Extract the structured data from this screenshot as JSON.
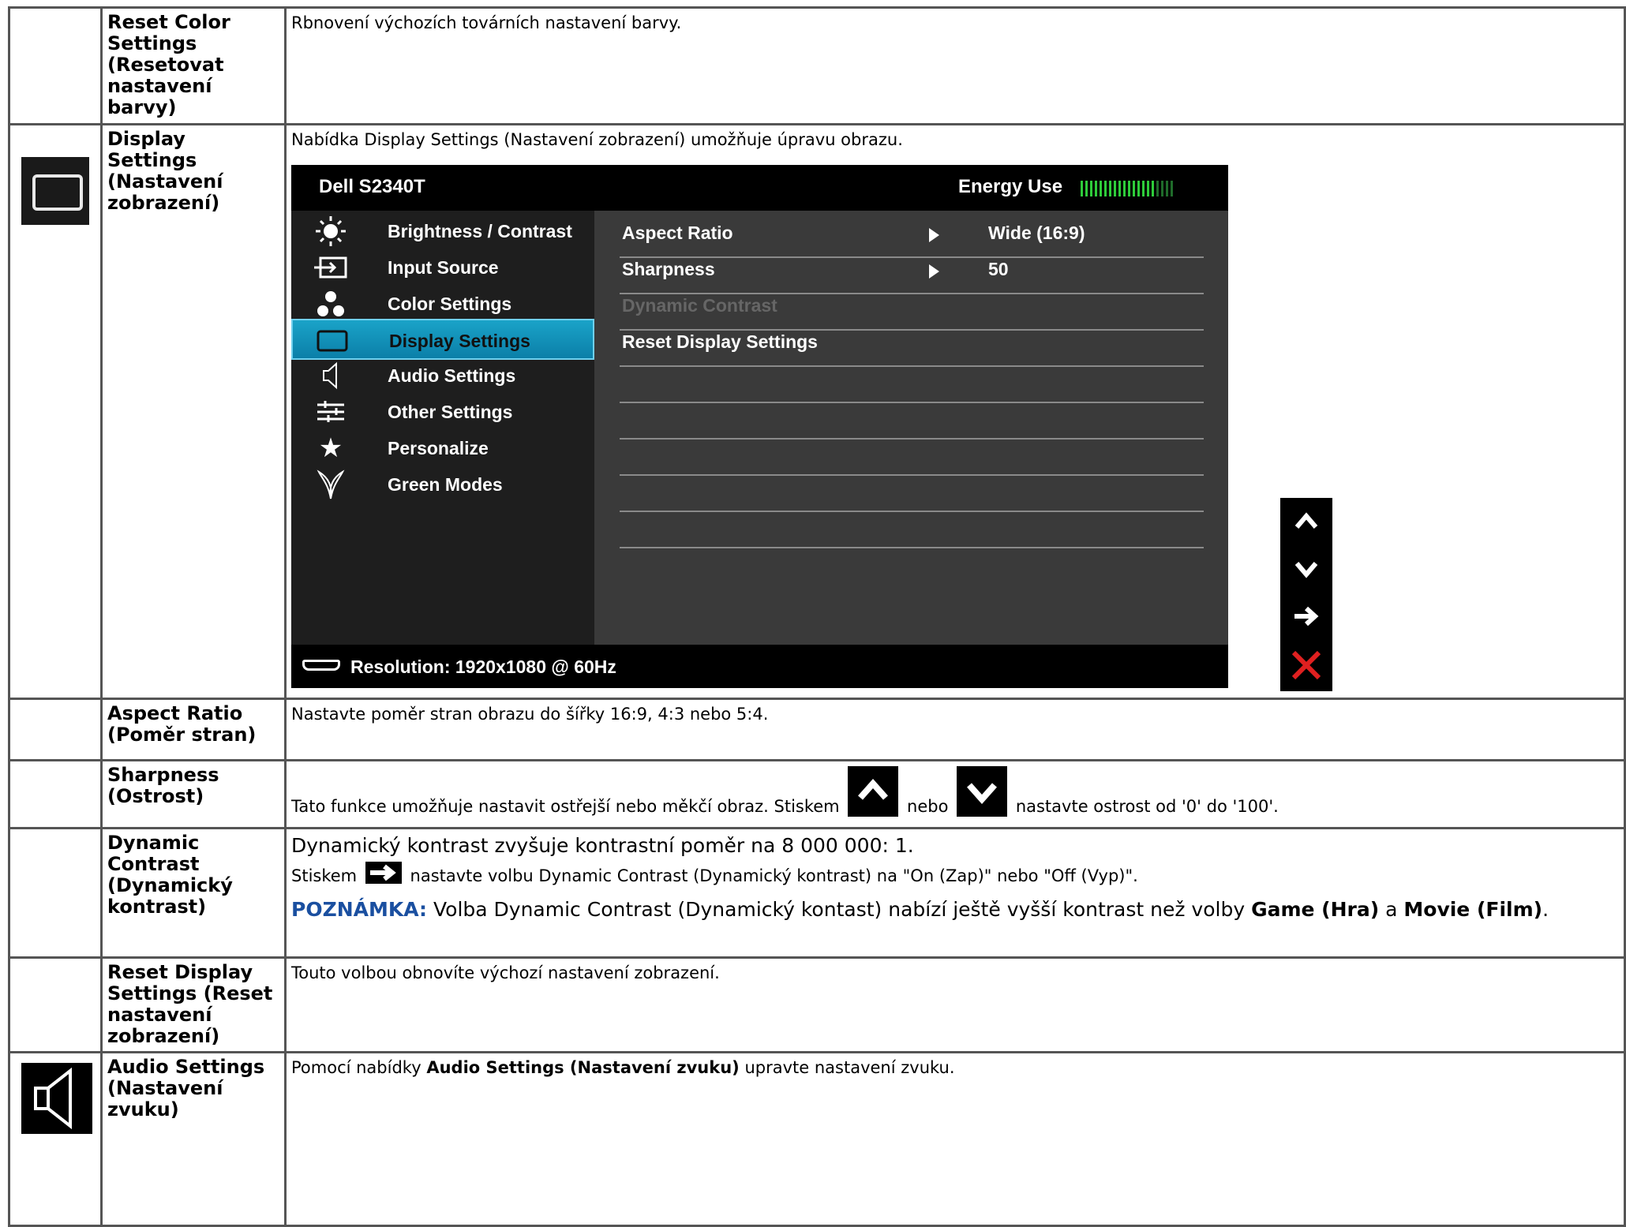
{
  "rows": {
    "reset_color": {
      "name": "Reset Color Settings (Resetovat nastavení barvy)",
      "desc": "Rbnovení výchozích továrních nastavení barvy."
    },
    "display_settings": {
      "name": "Display Settings (Nastavení zobrazení)",
      "desc": "Nabídka Display Settings (Nastavení zobrazení) umožňuje úpravu obrazu.",
      "icon": "monitor-icon"
    },
    "aspect_ratio": {
      "name": "Aspect Ratio (Poměr stran)",
      "desc": "Nastavte poměr stran obrazu do šířky 16:9, 4:3 nebo 5:4."
    },
    "sharpness": {
      "name": "Sharpness (Ostrost)",
      "desc_pre": "Tato funkce umožňuje nastavit ostřejší nebo měkčí obraz. Stiskem",
      "desc_mid": "nebo",
      "desc_post": "nastavte ostrost od '0' do '100'."
    },
    "dynamic_contrast": {
      "name": "Dynamic Contrast (Dynamický kontrast)",
      "line1": "Dynamický kontrast zvyšuje kontrastní poměr na 8 000 000: 1.",
      "line2_pre": "Stiskem",
      "line2_post": "nastavte volbu Dynamic Contrast (Dynamický kontrast) na \"On (Zap)\" nebo \"Off (Vyp)\".",
      "note_label": "POZNÁMKA:",
      "note_pre": "Volba Dynamic Contrast (Dynamický kontast) nabízí ještě vyšší kontrast než volby",
      "note_game": "Game (Hra)",
      "note_and": "a",
      "note_movie": "Movie (Film)",
      "note_end": "."
    },
    "reset_display": {
      "name": "Reset Display Settings (Reset nastavení zobrazení)",
      "desc": "Touto volbou obnovíte výchozí nastavení zobrazení."
    },
    "audio_settings": {
      "name": "Audio Settings (Nastavení zvuku)",
      "desc_pre": "Pomocí nabídky",
      "desc_bold": "Audio Settings (Nastavení zvuku)",
      "desc_post": "upravte nastavení zvuku.",
      "icon": "speaker-icon"
    }
  },
  "osd": {
    "model": "Dell S2340T",
    "energy_label": "Energy Use",
    "energy_level": 0.8,
    "menu": [
      {
        "label": "Brightness / Contrast",
        "icon": "brightness-icon"
      },
      {
        "label": "Input Source",
        "icon": "input-source-icon"
      },
      {
        "label": "Color Settings",
        "icon": "color-dots-icon"
      },
      {
        "label": "Display Settings",
        "icon": "monitor-icon",
        "active": true
      },
      {
        "label": "Audio Settings",
        "icon": "speaker-icon"
      },
      {
        "label": "Other Settings",
        "icon": "sliders-icon"
      },
      {
        "label": "Personalize",
        "icon": "star-icon"
      },
      {
        "label": "Green Modes",
        "icon": "leaf-icon"
      }
    ],
    "submenu": [
      {
        "label": "Aspect Ratio",
        "value": "Wide (16:9)"
      },
      {
        "label": "Sharpness",
        "value": "50"
      },
      {
        "label": "Dynamic Contrast",
        "value": "",
        "disabled": true
      },
      {
        "label": "Reset Display Settings",
        "value": ""
      }
    ],
    "resolution": "Resolution: 1920x1080 @ 60Hz",
    "nav_keys": [
      "up-arrow-icon",
      "down-arrow-icon",
      "right-arrow-icon",
      "close-x-icon"
    ],
    "colors": {
      "active": "#0b8fba",
      "energy": "#2ecc3a",
      "close": "#e02020"
    }
  }
}
